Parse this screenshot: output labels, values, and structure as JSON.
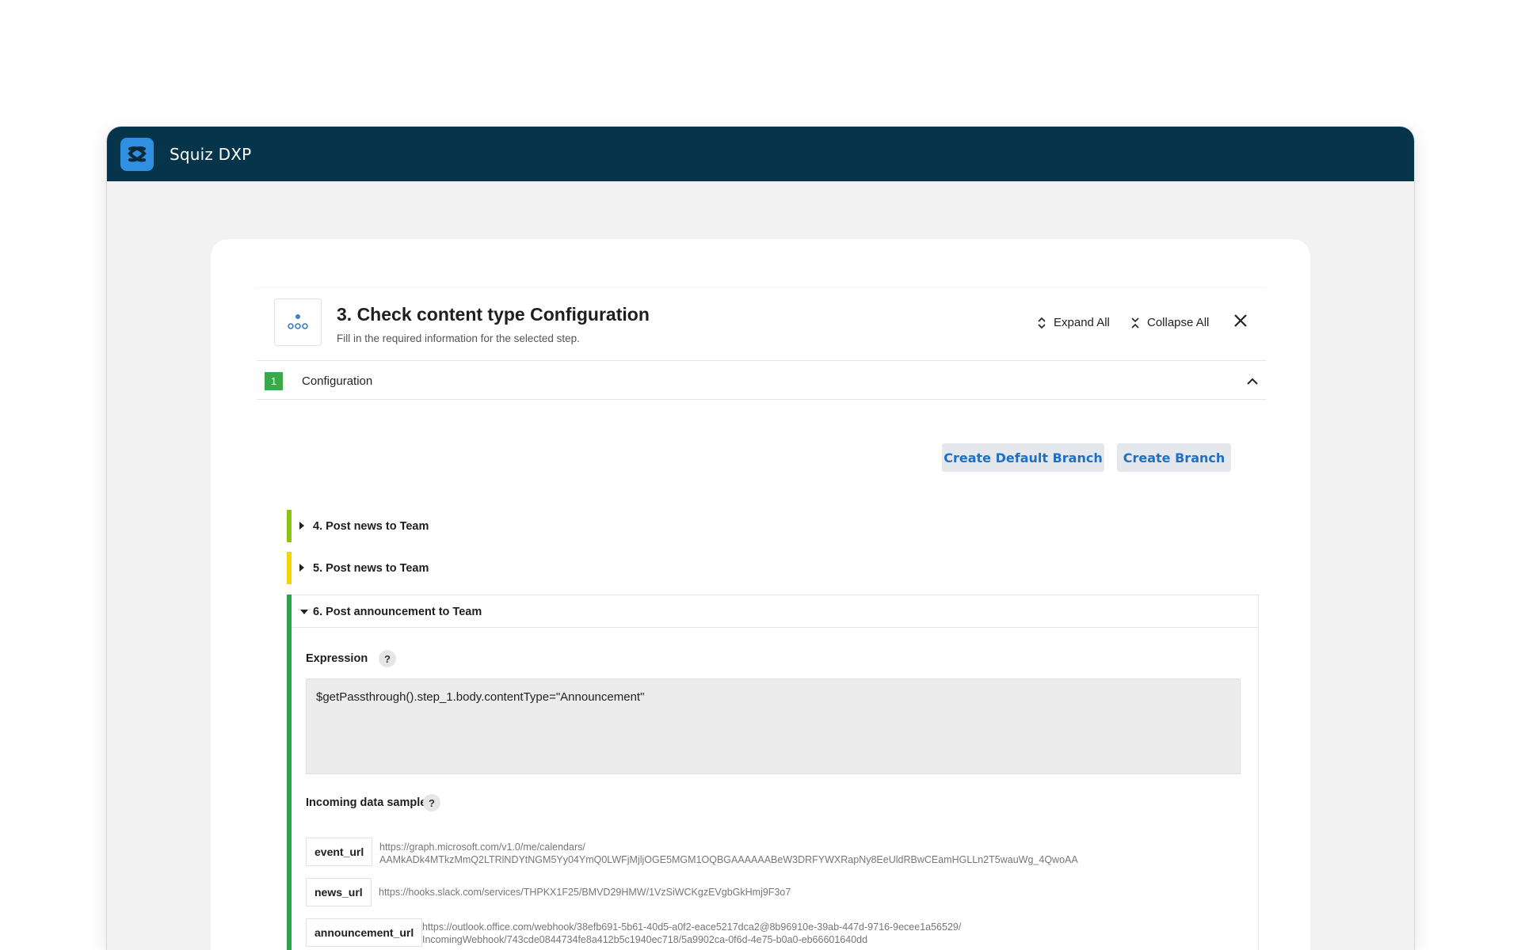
{
  "app": {
    "title": "Squiz DXP"
  },
  "step": {
    "title": "3. Check content type Configuration",
    "subtitle": "Fill in the required information for the selected step.",
    "expand_all": "Expand All",
    "collapse_all": "Collapse All"
  },
  "config": {
    "number": "1",
    "label": "Configuration"
  },
  "buttons": {
    "create_default_branch": "Create Default Branch",
    "create_branch": "Create Branch"
  },
  "branches": [
    {
      "label": "4. Post news to Team",
      "color": "#8bc414"
    },
    {
      "label": "5. Post news to Team",
      "color": "#f2d600"
    },
    {
      "label": "6. Post announcement to Team",
      "color": "#2ca24a"
    }
  ],
  "expression": {
    "label": "Expression",
    "help": "?",
    "value": "$getPassthrough().step_1.body.contentType=\"Announcement\""
  },
  "sample": {
    "label": "Incoming data sample",
    "help": "?",
    "items": [
      {
        "key": "event_url",
        "value_line1": "https://graph.microsoft.com/v1.0/me/calendars/",
        "value_line2": "AAMkADk4MTkzMmQ2LTRlNDYtNGM5Yy04YmQ0LWFjMjljOGE5MGM1OQBGAAAAAABeW3DRFYWXRapNy8EeUldRBwCEamHGLLn2T5wauWg_4QwoAA"
      },
      {
        "key": "news_url",
        "value_line1": "https://hooks.slack.com/services/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"
      },
      {
        "key": "announcement_url",
        "value_line1": "https://outlook.office.com/webhook/38efb691-5b61-40d5-a0f2-eace5217dca2@8b96910e-39ab-447d-9716-9ecee1a56529/",
        "value_line2": "IncomingWebhook/743cde0844734fe8a412b5c1940ec718/5a9902ca-0f6d-4e75-b0a0-eb66601640dd"
      }
    ]
  },
  "icons": {
    "logo": "squiz-logo-icon",
    "step": "branch-step-icon",
    "expand": "expand-arrows-icon",
    "collapse": "collapse-arrows-icon",
    "close": "close-icon",
    "chevron": "chevron-up-icon"
  }
}
